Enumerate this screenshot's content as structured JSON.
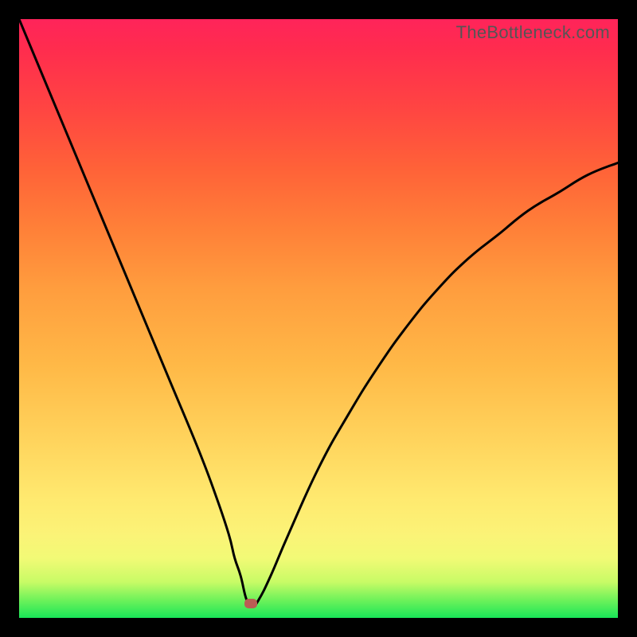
{
  "watermark": "TheBottleneck.com",
  "chart_data": {
    "type": "line",
    "title": "",
    "xlabel": "",
    "ylabel": "",
    "xlim": [
      0,
      100
    ],
    "ylim": [
      0,
      100
    ],
    "marker": {
      "x": 38.7,
      "y": 2.4
    },
    "series": [
      {
        "name": "curve",
        "x": [
          0,
          5,
          10,
          15,
          20,
          25,
          30,
          33,
          35,
          36,
          37,
          38,
          39,
          40,
          42,
          45,
          50,
          55,
          60,
          65,
          70,
          75,
          80,
          85,
          90,
          95,
          100
        ],
        "y": [
          100,
          88,
          76,
          64,
          52,
          40,
          28,
          20,
          14,
          10,
          7,
          3,
          2,
          3,
          7,
          14,
          25,
          34,
          42,
          49,
          55,
          60,
          64,
          68,
          71,
          74,
          76
        ]
      }
    ]
  }
}
